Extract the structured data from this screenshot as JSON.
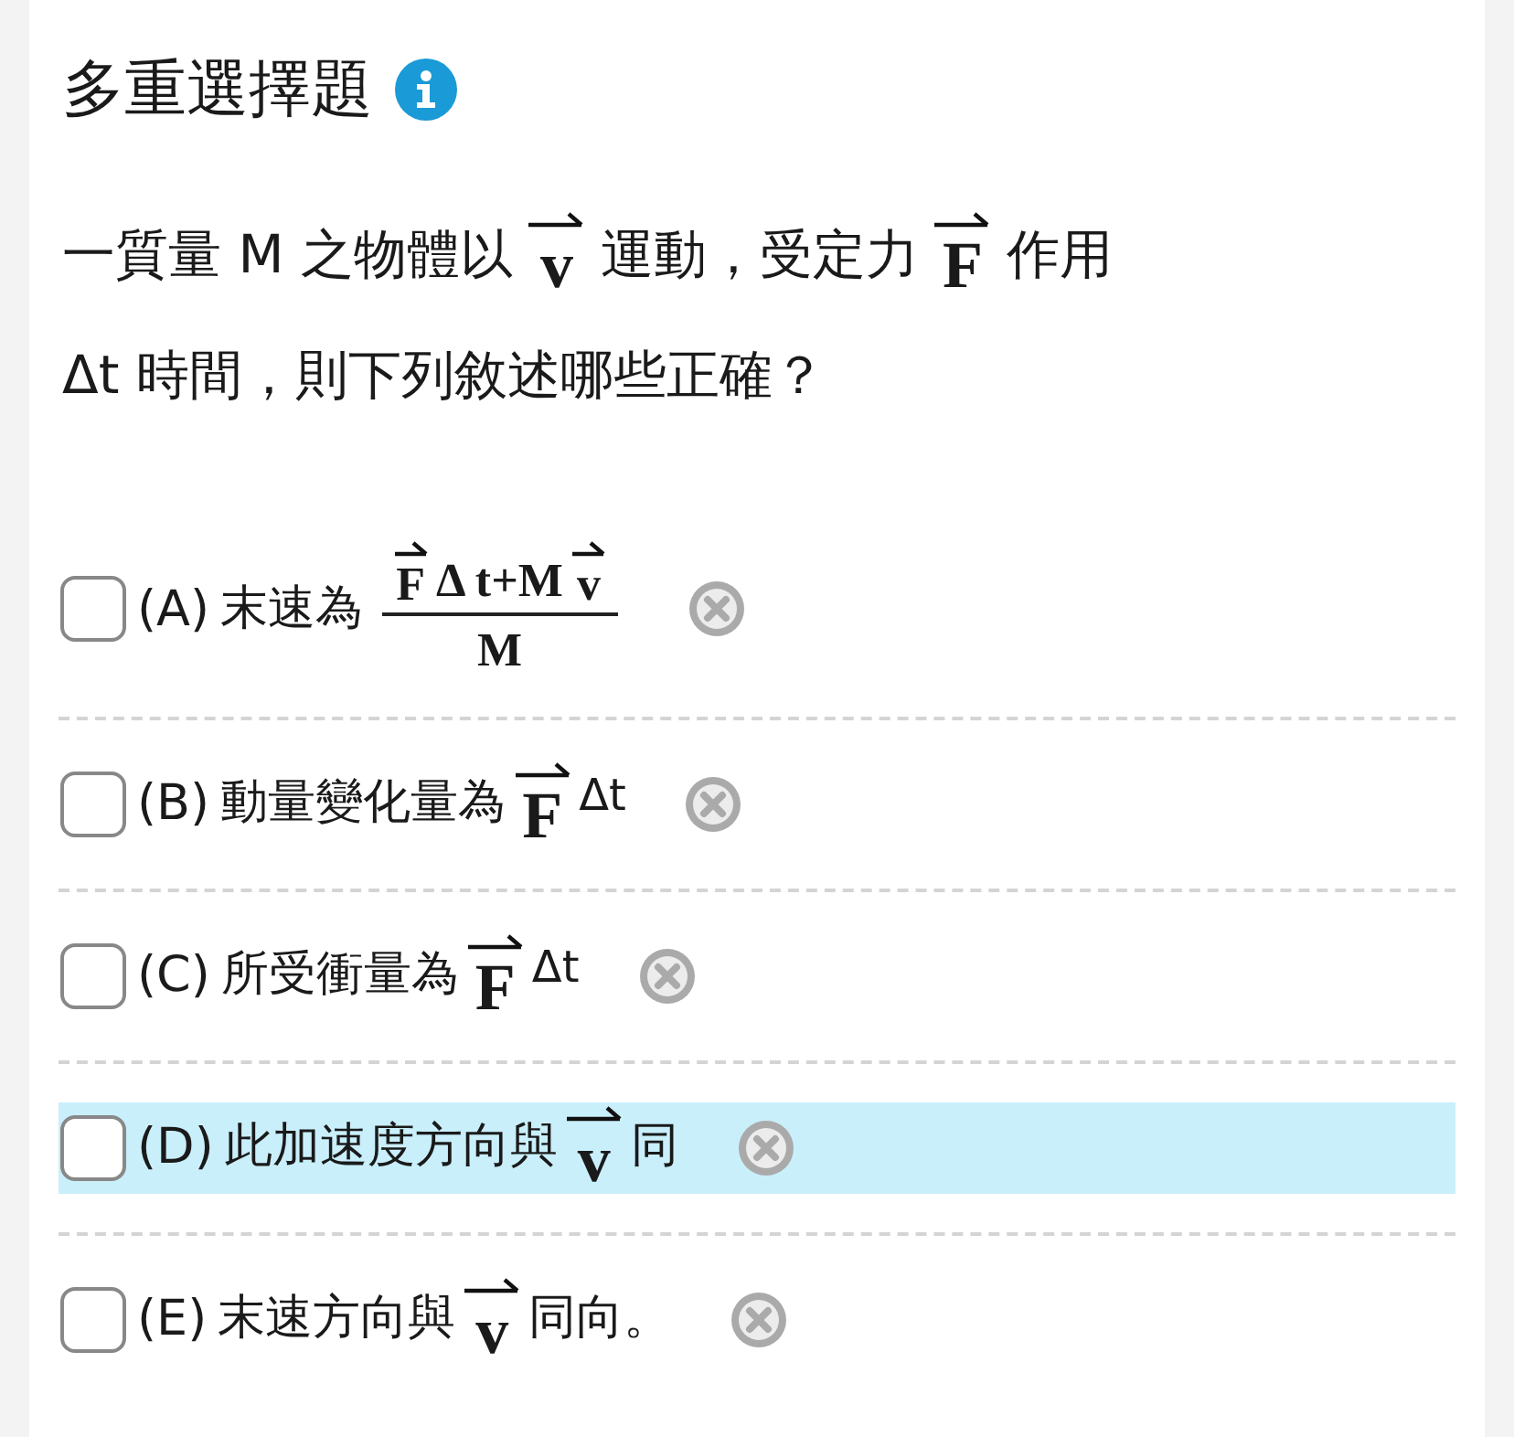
{
  "title": "多重選擇題",
  "question": {
    "lines": [
      [
        {
          "kind": "text",
          "text": "一質量 M 之物體以"
        },
        {
          "kind": "vector",
          "text": "v"
        },
        {
          "kind": "text",
          "text": "運動，受定力"
        },
        {
          "kind": "vector",
          "text": "F"
        },
        {
          "kind": "text",
          "text": "作用"
        }
      ],
      [
        {
          "kind": "text",
          "text": "Δt 時間，則下列敘述哪些正確？"
        }
      ]
    ]
  },
  "options": [
    {
      "label": "(A)",
      "checked": false,
      "highlighted": false,
      "parts": [
        {
          "kind": "text",
          "text": "末速為"
        },
        {
          "kind": "fraction",
          "numerator": [
            {
              "kind": "vector",
              "text": "F"
            },
            {
              "kind": "text",
              "text": "Δ t+M"
            },
            {
              "kind": "vector",
              "text": "v"
            }
          ],
          "denominator": [
            {
              "kind": "text",
              "text": "M"
            }
          ]
        }
      ]
    },
    {
      "label": "(B)",
      "checked": false,
      "highlighted": false,
      "parts": [
        {
          "kind": "text",
          "text": "動量變化量為"
        },
        {
          "kind": "vector",
          "text": "F"
        },
        {
          "kind": "sup",
          "text": "Δt"
        }
      ]
    },
    {
      "label": "(C)",
      "checked": false,
      "highlighted": false,
      "parts": [
        {
          "kind": "text",
          "text": "所受衝量為"
        },
        {
          "kind": "vector",
          "text": "F"
        },
        {
          "kind": "sup",
          "text": "Δt"
        }
      ]
    },
    {
      "label": "(D)",
      "checked": false,
      "highlighted": true,
      "parts": [
        {
          "kind": "text",
          "text": "此加速度方向與"
        },
        {
          "kind": "vector",
          "text": "v"
        },
        {
          "kind": "text",
          "text": "同"
        }
      ]
    },
    {
      "label": "(E)",
      "checked": false,
      "highlighted": false,
      "parts": [
        {
          "kind": "text",
          "text": "末速方向與"
        },
        {
          "kind": "vector",
          "text": "v"
        },
        {
          "kind": "text",
          "text": "同向。"
        }
      ]
    }
  ]
}
